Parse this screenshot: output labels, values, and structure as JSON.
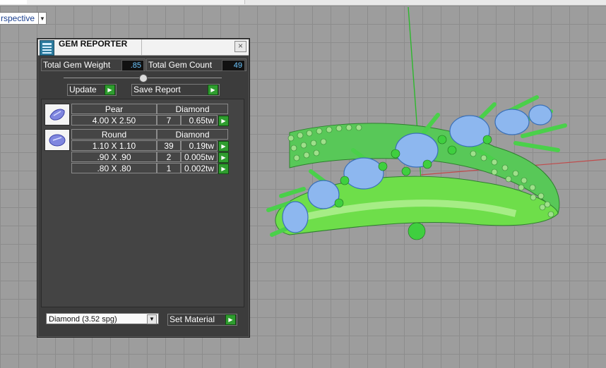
{
  "viewport": {
    "label": "rspective"
  },
  "panel": {
    "title": "GEM REPORTER",
    "total_weight_label": "Total Gem Weight",
    "total_weight_value": ".85",
    "total_count_label": "Total Gem Count",
    "total_count_value": "49",
    "update_label": "Update",
    "save_report_label": "Save Report",
    "groups": [
      {
        "shape": "Pear",
        "material": "Diamond",
        "rows": [
          {
            "size": "4.00 X 2.50",
            "count": "7",
            "weight": "0.65tw"
          }
        ]
      },
      {
        "shape": "Round",
        "material": "Diamond",
        "rows": [
          {
            "size": "1.10 X 1.10",
            "count": "39",
            "weight": "0.19tw"
          },
          {
            "size": ".90 X .90",
            "count": "2",
            "weight": "0.005tw"
          },
          {
            "size": ".80 X .80",
            "count": "1",
            "weight": "0.002tw"
          }
        ]
      }
    ],
    "material_select": "Diamond     (3.52 spg)",
    "set_material_label": "Set Material"
  },
  "colors": {
    "panel_bg": "#3c3c3c",
    "value_text": "#6cc6ff",
    "button_green": "#2f9d2f"
  }
}
